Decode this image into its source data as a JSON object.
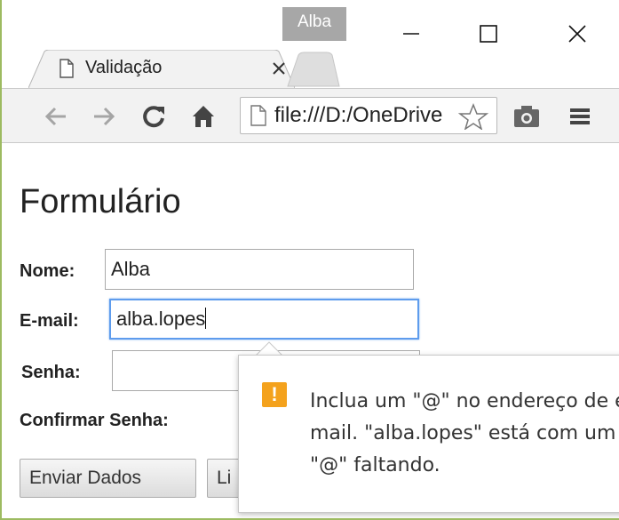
{
  "profile": {
    "name": "Alba"
  },
  "tab": {
    "title": "Validação"
  },
  "omnibox": {
    "url": "file:///D:/OneDrive"
  },
  "form": {
    "heading": "Formulário",
    "name_label": "Nome:",
    "name_value": "Alba",
    "email_label": "E-mail:",
    "email_value": "alba.lopes",
    "password_label": "Senha:",
    "confirm_label": "Confirmar Senha:",
    "submit_label": "Enviar Dados",
    "clear_label": "Li"
  },
  "validation_bubble": {
    "message": "Inclua um \"@\" no endereço de e-\nmail. \"alba.lopes\" está com um\n\"@\" faltando."
  },
  "colors": {
    "accent_focus": "#5e9ced",
    "warning": "#f4a21d",
    "window_border": "#9dbb61"
  }
}
